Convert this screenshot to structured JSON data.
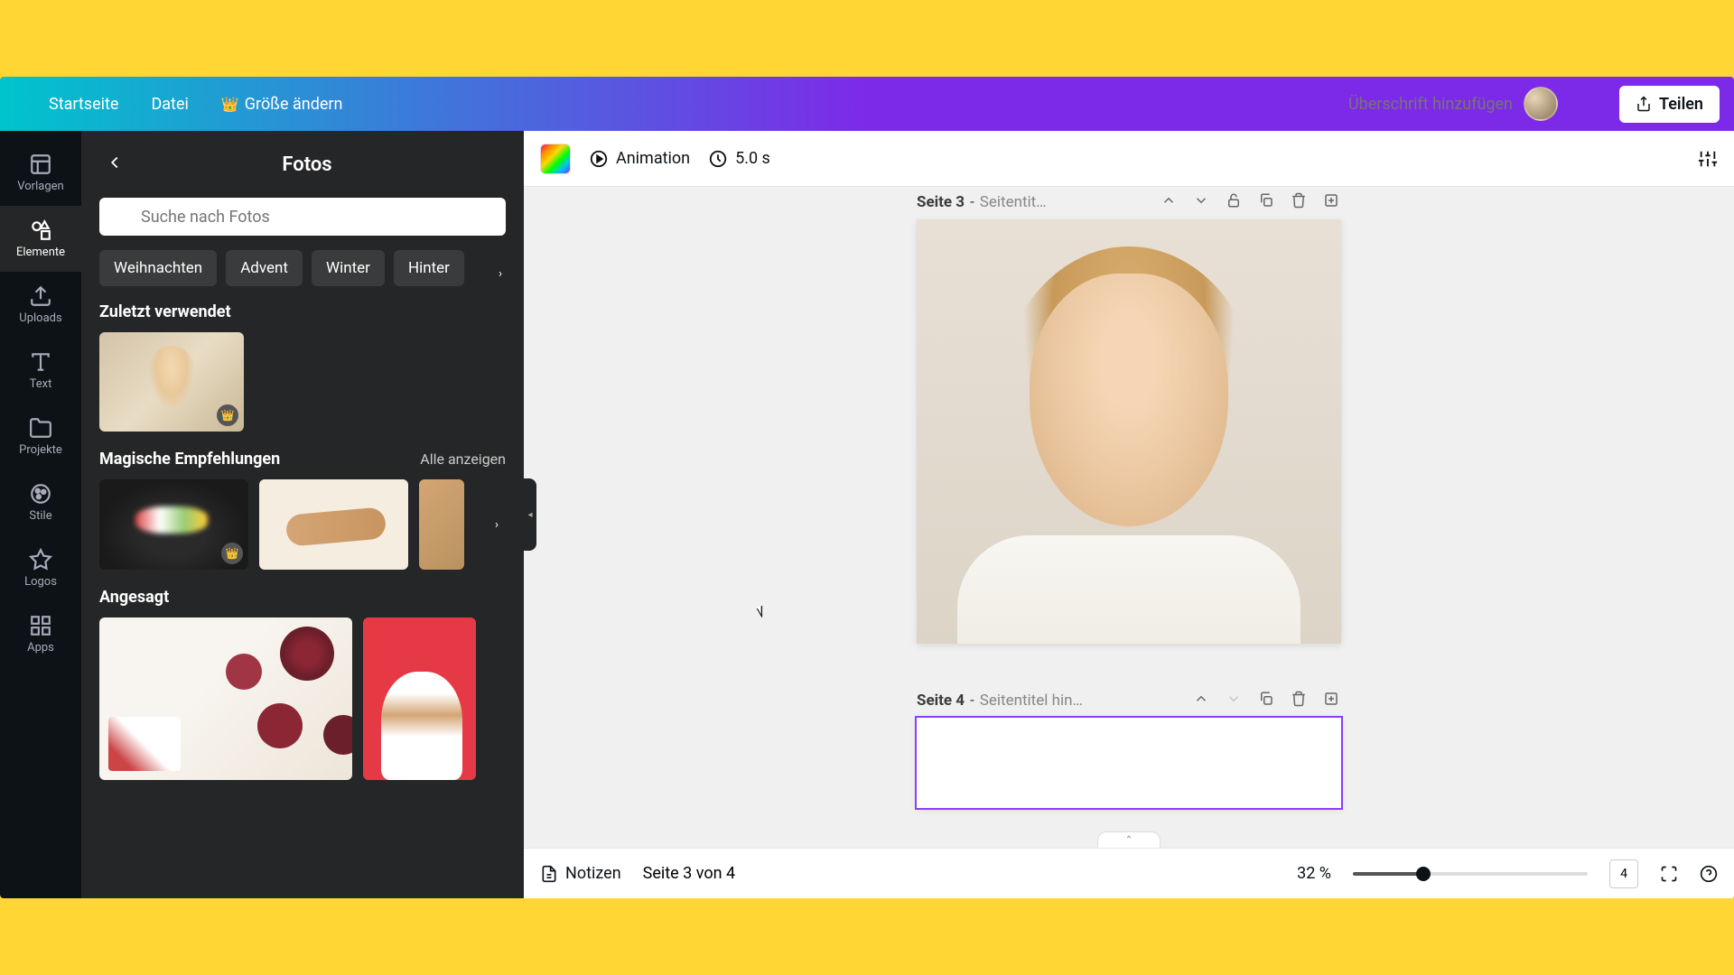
{
  "topbar": {
    "home": "Startseite",
    "file": "Datei",
    "resize": "Größe ändern",
    "title_placeholder": "Überschrift hinzufügen",
    "share": "Teilen"
  },
  "rail": {
    "templates": "Vorlagen",
    "elements": "Elemente",
    "uploads": "Uploads",
    "text": "Text",
    "projects": "Projekte",
    "styles": "Stile",
    "logos": "Logos",
    "apps": "Apps"
  },
  "panel": {
    "title": "Fotos",
    "search_placeholder": "Suche nach Fotos",
    "chips": [
      "Weihnachten",
      "Advent",
      "Winter",
      "Hinter"
    ],
    "recent_title": "Zuletzt verwendet",
    "recommend_title": "Magische Empfehlungen",
    "see_all": "Alle anzeigen",
    "trending_title": "Angesagt"
  },
  "context": {
    "animation": "Animation",
    "duration": "5.0 s"
  },
  "pages": {
    "p3_label": "Seite 3",
    "p3_title": "Seitentit…",
    "p4_label": "Seite 4",
    "p4_title": "Seitentitel hin…"
  },
  "footer": {
    "notes": "Notizen",
    "page_indicator": "Seite 3 von 4",
    "zoom": "32 %",
    "page_count": "4"
  }
}
